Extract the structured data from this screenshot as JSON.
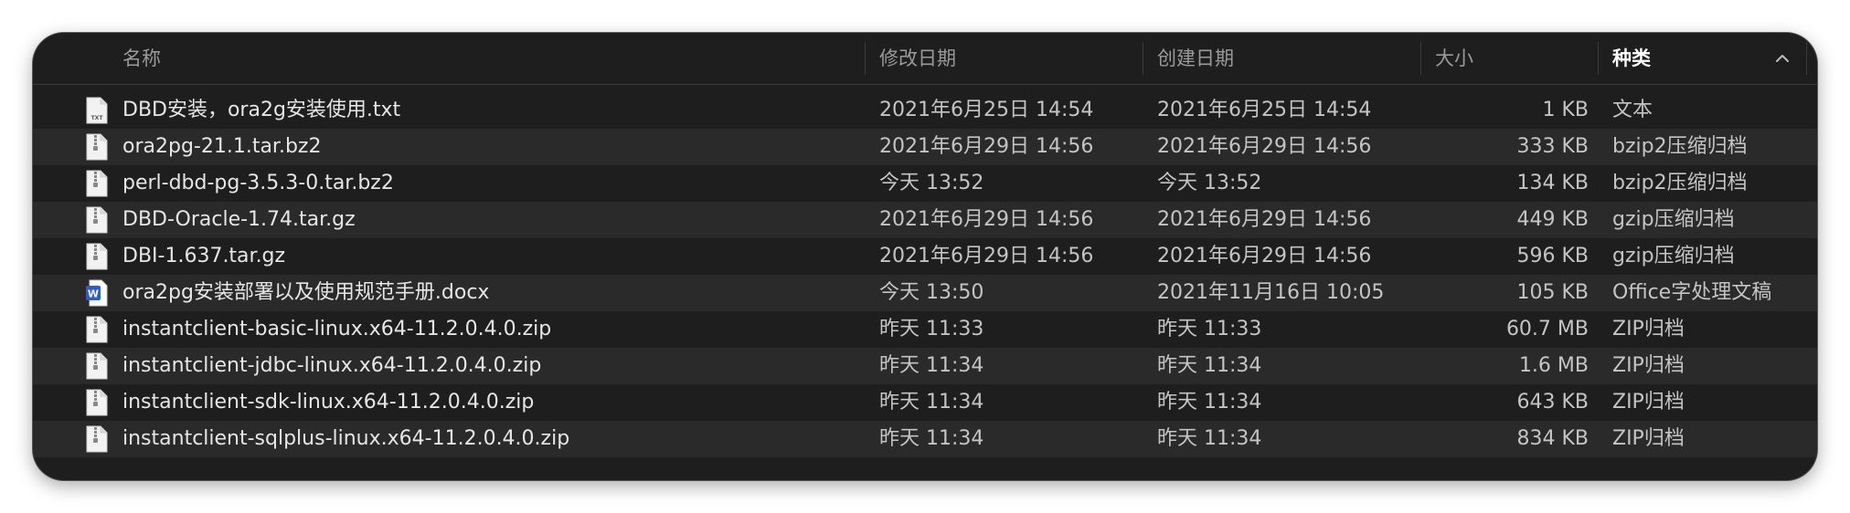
{
  "header": {
    "name": "名称",
    "modified": "修改日期",
    "created": "创建日期",
    "size": "大小",
    "kind": "种类"
  },
  "files": [
    {
      "name": "DBD安装，ora2g安装使用.txt",
      "modified": "2021年6月25日 14:54",
      "created": "2021年6月25日 14:54",
      "size": "1 KB",
      "kind": "文本",
      "icon": "text-file-icon"
    },
    {
      "name": "ora2pg-21.1.tar.bz2",
      "modified": "2021年6月29日 14:56",
      "created": "2021年6月29日 14:56",
      "size": "333 KB",
      "kind": "bzip2压缩归档",
      "icon": "archive-file-icon"
    },
    {
      "name": "perl-dbd-pg-3.5.3-0.tar.bz2",
      "modified": "今天 13:52",
      "created": "今天 13:52",
      "size": "134 KB",
      "kind": "bzip2压缩归档",
      "icon": "archive-file-icon"
    },
    {
      "name": "DBD-Oracle-1.74.tar.gz",
      "modified": "2021年6月29日 14:56",
      "created": "2021年6月29日 14:56",
      "size": "449 KB",
      "kind": "gzip压缩归档",
      "icon": "archive-file-icon"
    },
    {
      "name": "DBI-1.637.tar.gz",
      "modified": "2021年6月29日 14:56",
      "created": "2021年6月29日 14:56",
      "size": "596 KB",
      "kind": "gzip压缩归档",
      "icon": "archive-file-icon"
    },
    {
      "name": "ora2pg安装部署以及使用规范手册.docx",
      "modified": "今天 13:50",
      "created": "2021年11月16日 10:05",
      "size": "105 KB",
      "kind": "Office字处理文稿",
      "icon": "word-document-icon"
    },
    {
      "name": "instantclient-basic-linux.x64-11.2.0.4.0.zip",
      "modified": "昨天 11:33",
      "created": "昨天 11:33",
      "size": "60.7 MB",
      "kind": "ZIP归档",
      "icon": "zip-file-icon"
    },
    {
      "name": "instantclient-jdbc-linux.x64-11.2.0.4.0.zip",
      "modified": "昨天 11:34",
      "created": "昨天 11:34",
      "size": "1.6 MB",
      "kind": "ZIP归档",
      "icon": "zip-file-icon"
    },
    {
      "name": "instantclient-sdk-linux.x64-11.2.0.4.0.zip",
      "modified": "昨天 11:34",
      "created": "昨天 11:34",
      "size": "643 KB",
      "kind": "ZIP归档",
      "icon": "zip-file-icon"
    },
    {
      "name": "instantclient-sqlplus-linux.x64-11.2.0.4.0.zip",
      "modified": "昨天 11:34",
      "created": "昨天 11:34",
      "size": "834 KB",
      "kind": "ZIP归档",
      "icon": "zip-file-icon"
    }
  ],
  "colors": {
    "window_bg": "#1e1e1e",
    "row_alt_bg": "#2a2a2a",
    "word_blue": "#2b5cd6"
  }
}
